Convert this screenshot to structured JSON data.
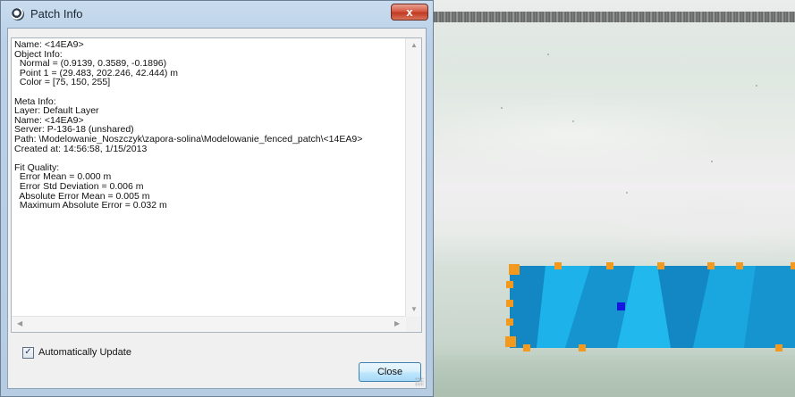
{
  "window": {
    "title": "Patch Info",
    "close_glyph": "x",
    "app_icon": "app-swirl-icon"
  },
  "info": {
    "lines": [
      "Name: <14EA9>",
      "Object Info:",
      "  Normal = (0.9139, 0.3589, -0.1896)",
      "  Point 1 = (29.483, 202.246, 42.444) m",
      "  Color = [75, 150, 255]",
      "",
      "Meta Info:",
      "Layer: Default Layer",
      "Name: <14EA9>",
      "Server: P-136-18 (unshared)",
      "Path: \\Modelowanie_Noszczyk\\zapora-solina\\Modelowanie_fenced_patch\\<14EA9>",
      "Created at: 14:56:58, 1/15/2013",
      "",
      "Fit Quality:",
      "  Error Mean = 0.000 m",
      "  Error Std Deviation = 0.006 m",
      "  Absolute Error Mean = 0.005 m",
      "  Maximum Absolute Error = 0.032 m"
    ]
  },
  "scroll": {
    "up": "▲",
    "down": "▼",
    "left": "◀",
    "right": "▶"
  },
  "auto_update": {
    "label": "Automatically Update",
    "checked": true,
    "check_glyph": "✓"
  },
  "buttons": {
    "close_label": "Close"
  },
  "colors": {
    "patch_fill": "#1aa6df",
    "patch_dark": "#1287c4",
    "handle": "#f39a1e",
    "center_marker": "#1616e0"
  }
}
